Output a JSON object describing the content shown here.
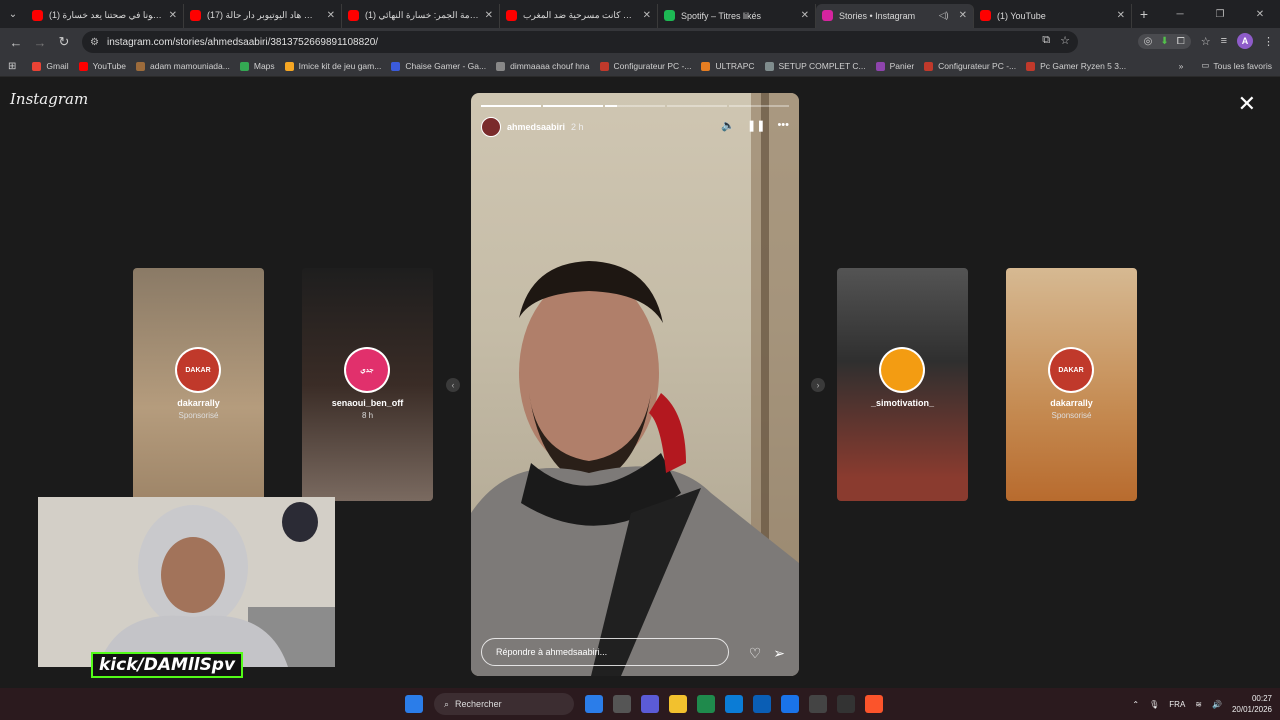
{
  "tabs": [
    {
      "title": "(1) هلكونا في صحتنا يعد خسارة",
      "favicon_color": "#ff0000",
      "active": false
    },
    {
      "title": "(17) علاش هاد اليوتيوبر دار حالة",
      "favicon_color": "#ff0000",
      "active": false
    },
    {
      "title": "(1) صدمة الجمر: خسارة النهائي ..",
      "favicon_color": "#ff0000",
      "active": false
    },
    {
      "title": "واش كانت مسرحية ضد المغرب ..",
      "favicon_color": "#ff0000",
      "active": false
    },
    {
      "title": "Spotify – Titres likés",
      "favicon_color": "#1db954",
      "active": false
    },
    {
      "title": "Stories • Instagram",
      "favicon_color": "#d6249f",
      "active": true,
      "extra": "◁)"
    },
    {
      "title": "(1) YouTube",
      "favicon_color": "#ff0000",
      "active": false
    }
  ],
  "address": {
    "url": "instagram.com/stories/ahmedsaabiri/3813752669891108820/"
  },
  "bookmarks": [
    {
      "label": "Gmail",
      "color": "#ea4335"
    },
    {
      "label": "YouTube",
      "color": "#ff0000"
    },
    {
      "label": "adam mamouniada...",
      "color": "#9c6b3b"
    },
    {
      "label": "Maps",
      "color": "#34a853"
    },
    {
      "label": "Imice kit de jeu gam...",
      "color": "#f5a623"
    },
    {
      "label": "Chaise Gamer - Ga...",
      "color": "#3b5bdb"
    },
    {
      "label": "dimmaaaa chouf hna",
      "color": "#888888"
    },
    {
      "label": "Configurateur PC -...",
      "color": "#c0392b"
    },
    {
      "label": "ULTRAPC",
      "color": "#e67e22"
    },
    {
      "label": "SETUP COMPLET C...",
      "color": "#7f8c8d"
    },
    {
      "label": "Panier",
      "color": "#8e44ad"
    },
    {
      "label": "Configurateur PC -...",
      "color": "#c0392b"
    },
    {
      "label": "Pc Gamer Ryzen 5 3...",
      "color": "#c0392b"
    }
  ],
  "bookmarks_all": "Tous les favoris",
  "instagram": {
    "logo": "Instagram",
    "side_stories": [
      {
        "username": "dakarrally",
        "sub": "Sponsorisé",
        "ring_label": "DAKAR",
        "bg": "linear-gradient(180deg,#8a7a66,#b59c7d 60%,#9e8568)",
        "ring": "#c0392b"
      },
      {
        "username": "senaoui_ben_off",
        "sub": "8 h",
        "ring_label": "جدي",
        "bg": "linear-gradient(180deg,#1e1e1e,#3a2c26 50%,#7a6a60)",
        "ring": "#e1306c"
      },
      {
        "username": "_simotivation_",
        "sub": "",
        "ring_label": "",
        "bg": "linear-gradient(180deg,#545454,#2f2f2f 40%,#8a3b2f 90%)",
        "ring": "#f39c12"
      },
      {
        "username": "dakarrally",
        "sub": "Sponsorisé",
        "ring_label": "DAKAR",
        "bg": "linear-gradient(180deg,#d6b992,#c58b52 60%,#b86b2e)",
        "ring": "#c0392b"
      }
    ],
    "main_story": {
      "username": "ahmedsaabiri",
      "time": "2 h",
      "reply_placeholder": "Répondre à ahmedsaabiri..."
    }
  },
  "overlay": {
    "kick_tag": "kick/DAMllSpv"
  },
  "taskbar": {
    "search": "Rechercher",
    "lang": "FRA",
    "time": "00:27",
    "date": "20/01/2026",
    "icon_colors": [
      "#2b7de9",
      "#555",
      "#5b5bd6",
      "#f2c12e",
      "#1f8a4c",
      "#0b7cd6",
      "#0a5eb5",
      "#1a73e8",
      "#444",
      "#333",
      "#fb542b"
    ]
  }
}
